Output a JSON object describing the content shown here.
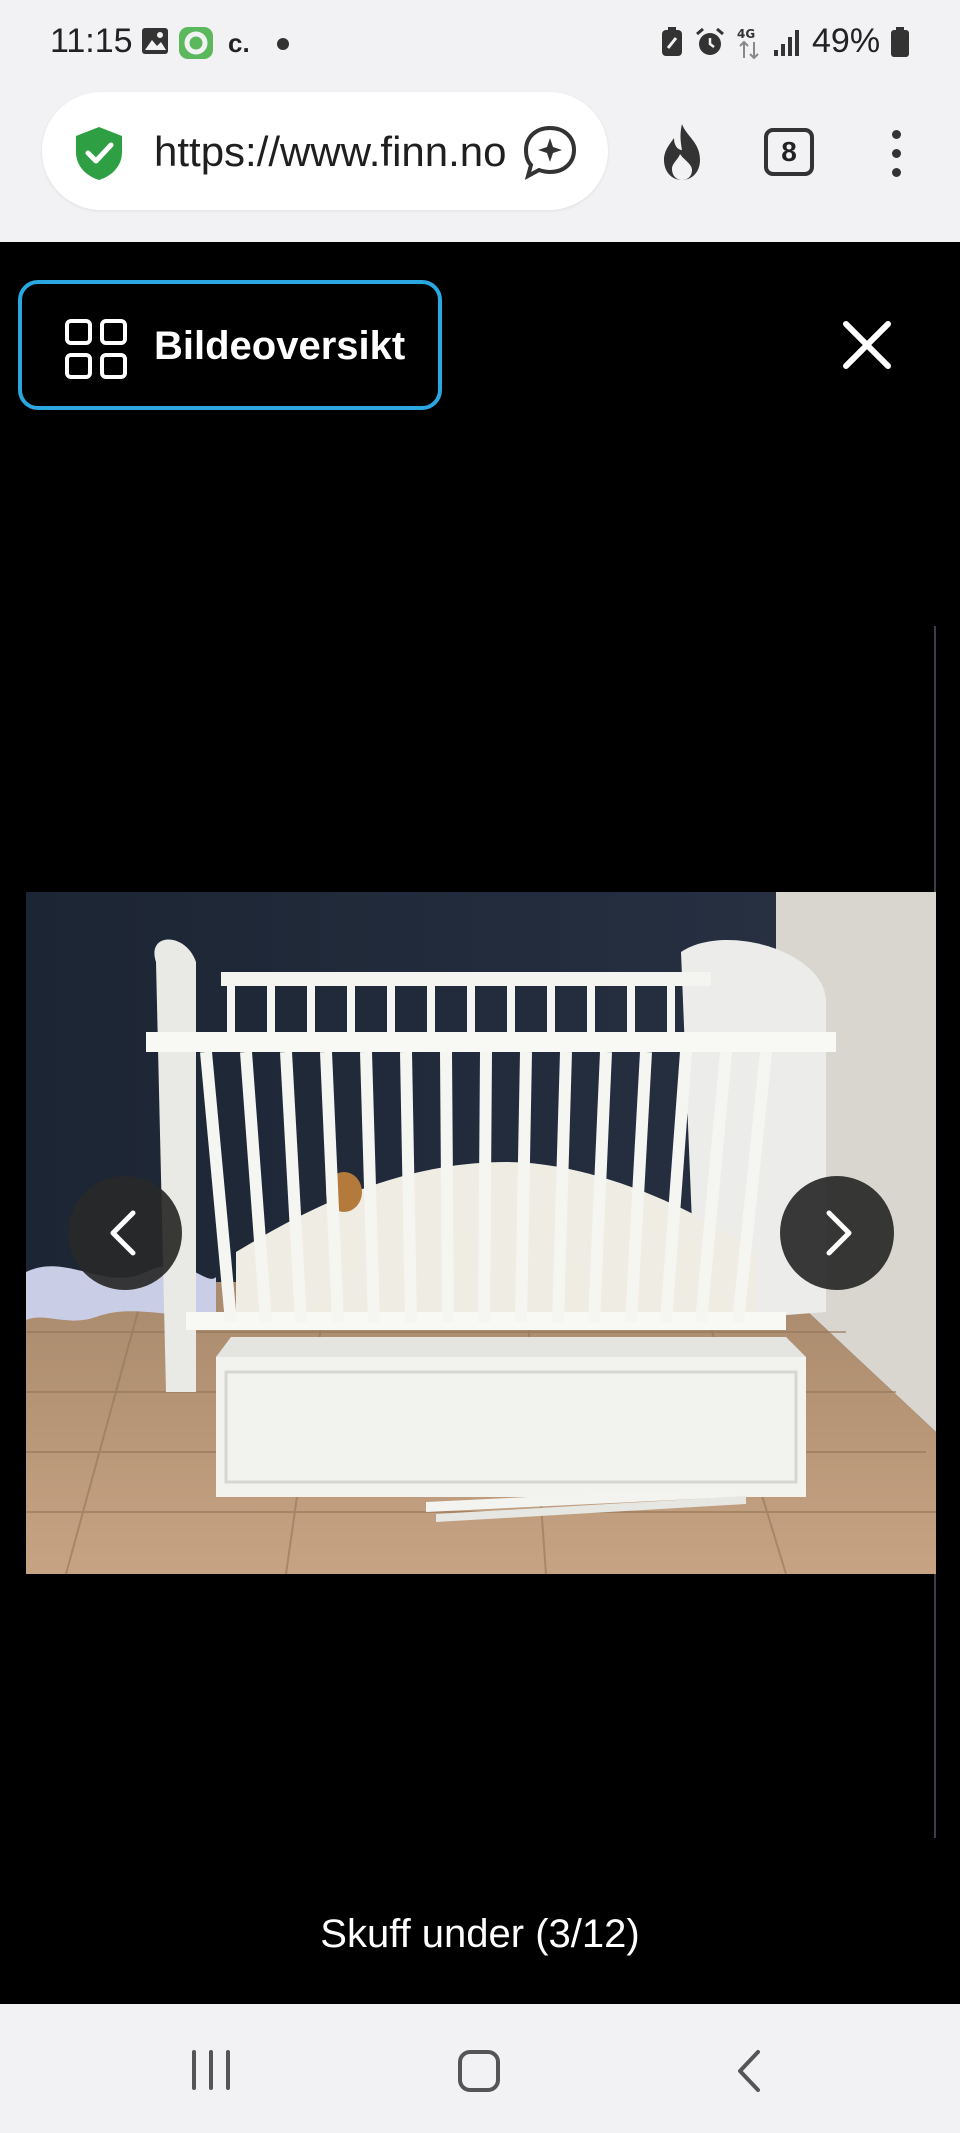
{
  "status_bar": {
    "time": "11:15",
    "indicator": "c.",
    "battery_percent": "49%"
  },
  "browser": {
    "url": "https://www.finn.no",
    "tab_count": "8",
    "shield_color": "#2ea043"
  },
  "viewer": {
    "overview_label": "Bildeoversikt",
    "caption": "Skuff under (3/12)",
    "accent": "#2aa7e1"
  },
  "icons": {
    "status": [
      "gallery-icon",
      "app-icon",
      "battery-saver-icon",
      "alarm-icon",
      "4g-icon",
      "signal-icon",
      "battery-icon"
    ],
    "browser": [
      "shield-check-icon",
      "assistant-icon",
      "fire-icon",
      "tabs-icon",
      "more-vert-icon"
    ],
    "viewer": [
      "grid-icon",
      "close-icon",
      "chevron-left-icon",
      "chevron-right-icon"
    ],
    "nav": [
      "recents-icon",
      "home-icon",
      "back-icon"
    ]
  }
}
